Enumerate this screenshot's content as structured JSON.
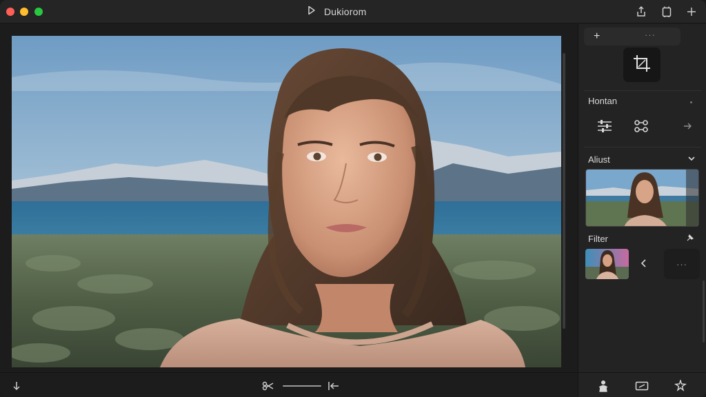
{
  "window": {
    "title": "Dukiorom"
  },
  "titlebar_icons": [
    "play-icon",
    "share-icon",
    "copy-frame-icon",
    "add-icon"
  ],
  "panel": {
    "top_more": "···",
    "section1": {
      "title": "Hontan"
    },
    "section2": {
      "title": "Aliust"
    },
    "section3": {
      "title": "Filter"
    },
    "filter_more": "···"
  },
  "colors": {
    "window_bg": "#1c1c1d",
    "panel_bg": "#232324",
    "titlebar_bg": "#252526",
    "close": "#ff5f57",
    "minimize": "#febc2e",
    "zoom": "#28c840"
  }
}
